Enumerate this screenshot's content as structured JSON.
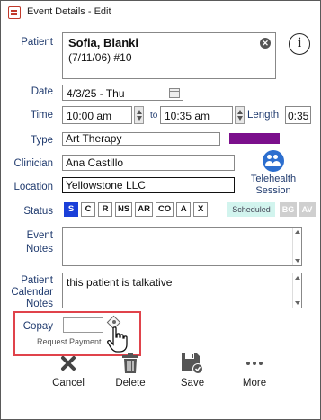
{
  "window": {
    "title": "Event Details - Edit"
  },
  "patient": {
    "label": "Patient",
    "name": "Sofia, Blanki",
    "details": "(7/11/06) #10"
  },
  "date": {
    "label": "Date",
    "value": "4/3/25 - Thu"
  },
  "time": {
    "label": "Time",
    "start": "10:00 am",
    "to": "to",
    "end": "10:35 am",
    "length_label": "Length",
    "length": "0:35"
  },
  "type": {
    "label": "Type",
    "value": "Art Therapy",
    "color": "#7b0f8c"
  },
  "clinician": {
    "label": "Clinician",
    "value": "Ana Castillo"
  },
  "location": {
    "label": "Location",
    "value": "Yellowstone LLC"
  },
  "telehealth": {
    "line1": "Telehealth",
    "line2": "Session"
  },
  "status": {
    "label": "Status",
    "buttons": [
      "S",
      "C",
      "R",
      "NS",
      "AR",
      "CO",
      "A",
      "X"
    ],
    "active": "S",
    "scheduled_text": "Scheduled",
    "bg_label": "BG",
    "av_label": "AV"
  },
  "event_notes": {
    "label_line1": "Event",
    "label_line2": "Notes",
    "value": ""
  },
  "patient_calendar_notes": {
    "label_line1": "Patient",
    "label_line2": "Calendar",
    "label_line3": "Notes",
    "value": "this patient is talkative"
  },
  "copay": {
    "label": "Copay",
    "value": "",
    "request_payment": "Request Payment"
  },
  "actions": {
    "cancel": "Cancel",
    "delete": "Delete",
    "save": "Save",
    "more": "More"
  },
  "colors": {
    "label_blue": "#1f3a6e",
    "status_active": "#1a3fd9",
    "highlight": "#e0434b",
    "telehealth_icon": "#2d6fcf"
  }
}
